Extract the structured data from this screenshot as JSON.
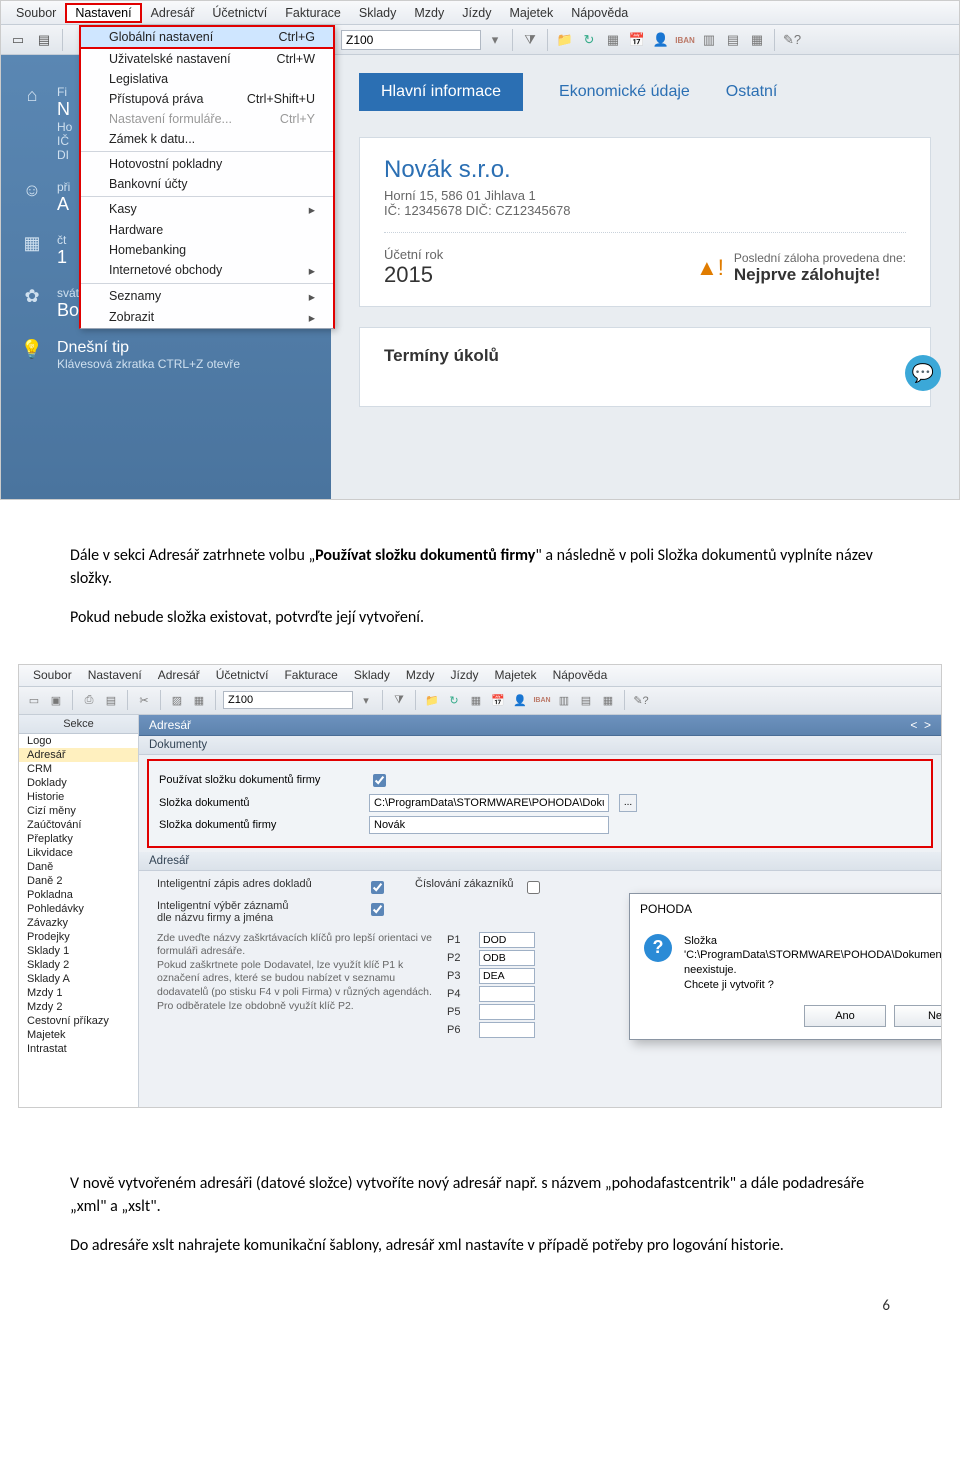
{
  "menubar1": [
    "Soubor",
    "Nastavení",
    "Adresář",
    "Účetnictví",
    "Fakturace",
    "Sklady",
    "Mzdy",
    "Jízdy",
    "Majetek",
    "Nápověda"
  ],
  "menubar1_active_index": 1,
  "dropdown": [
    {
      "label": "Globální nastavení",
      "shortcut": "Ctrl+G",
      "hl": true
    },
    {
      "label": "Uživatelské nastavení",
      "shortcut": "Ctrl+W"
    },
    {
      "label": "Legislativa",
      "shortcut": ""
    },
    {
      "label": "Přístupová práva",
      "shortcut": "Ctrl+Shift+U"
    },
    {
      "label": "Nastavení formuláře...",
      "shortcut": "Ctrl+Y",
      "disabled": true
    },
    {
      "label": "Zámek k datu...",
      "shortcut": ""
    },
    {
      "sep": true
    },
    {
      "label": "Hotovostní pokladny",
      "shortcut": ""
    },
    {
      "label": "Bankovní účty",
      "shortcut": ""
    },
    {
      "sep": true
    },
    {
      "label": "Kasy",
      "arrow": true
    },
    {
      "label": "Hardware",
      "shortcut": ""
    },
    {
      "label": "Homebanking",
      "shortcut": ""
    },
    {
      "label": "Internetové obchody",
      "arrow": true
    },
    {
      "sep": true
    },
    {
      "label": "Seznamy",
      "arrow": true
    },
    {
      "label": "Zobrazit",
      "arrow": true
    }
  ],
  "toolbar_input": "Z100",
  "sidebar1": {
    "firm_label": "Fi",
    "firm_name": "N",
    "firm_addr": "Ho",
    "ic": "IČ",
    "dic": "DI",
    "pri": "při",
    "agenda": "A",
    "ct": "čt",
    "date": "1",
    "svatek_label": "svátek má",
    "svatek_name": "Bonifác",
    "tip_title": "Dnešní tip",
    "tip_text": "Klávesová zkratka CTRL+Z otevře"
  },
  "tabs1": [
    "Hlavní informace",
    "Ekonomické údaje",
    "Ostatní"
  ],
  "card1": {
    "title": "Novák s.r.o.",
    "addr": "Horní 15, 586 01 Jihlava 1",
    "ids": "IČ: 12345678  DIČ: CZ12345678",
    "rok_label": "Účetní rok",
    "rok": "2015",
    "warn1": "Poslední záloha provedena dne:",
    "warn2": "Nejprve zálohujte!"
  },
  "card2_title": "Termíny úkolů",
  "para1": {
    "pre": "Dále v sekci Adresář zatrhnete volbu „",
    "b1": "Používat složku dokumentů firmy",
    "mid": "\" a následně v poli Složka dokumentů vyplníte název složky.",
    "p2": "Pokud nebude složka existovat, potvrďte její vytvoření."
  },
  "menubar2": [
    "Soubor",
    "Nastavení",
    "Adresář",
    "Účetnictví",
    "Fakturace",
    "Sklady",
    "Mzdy",
    "Jízdy",
    "Majetek",
    "Nápověda"
  ],
  "toolbar2_input": "Z100",
  "sekce_header": "Sekce",
  "sekce_items": [
    "Logo",
    "Adresář",
    "CRM",
    "Doklady",
    "Historie",
    "Cizí měny",
    "Zaúčtování",
    "Přeplatky",
    "Likvidace",
    "Daně",
    "Daně 2",
    "Pokladna",
    "Pohledávky",
    "Závazky",
    "Prodejky",
    "Sklady 1",
    "Sklady 2",
    "Sklady A",
    "Mzdy 1",
    "Mzdy 2",
    "Cestovní příkazy",
    "Majetek",
    "Intrastat"
  ],
  "sekce_selected": 1,
  "pathbar_title": "Adresář",
  "section_doc": "Dokumenty",
  "redbox": {
    "r1_label": "Používat složku dokumentů firmy",
    "r2_label": "Složka dokumentů",
    "r2_value": "C:\\ProgramData\\STORMWARE\\POHODA\\Doku...\\",
    "r3_label": "Složka dokumentů firmy",
    "r3_value": "Novák"
  },
  "section_adr": "Adresář",
  "below": {
    "r1": "Inteligentní zápis adres dokladů",
    "r2a": "Inteligentní výběr záznamů",
    "r2b": "dle názvu firmy a jména",
    "cislovani": "Číslování zákazníků",
    "desc": "Zde uveďte názvy zaškrtávacích klíčů pro lepší orientaci ve formuláři adresáře.\nPokud zaškrtnete pole Dodavatel, lze využít klíč P1 k označení adres, které se budou nabízet v seznamu dodavatelů (po stisku F4 v poli Firma) v různých agendách. Pro odběratele lze obdobně využít klíč P2.",
    "p_labels": [
      "P1",
      "P2",
      "P3",
      "P4",
      "P5",
      "P6"
    ],
    "p_vals": [
      "DOD",
      "ODB",
      "DEA",
      "",
      "",
      ""
    ]
  },
  "dialog": {
    "title": "POHODA",
    "msg1": "Složka 'C:\\ProgramData\\STORMWARE\\POHODA\\Dokumenty\\Novák' neexistuje.",
    "msg2": "Chcete ji vytvořit ?",
    "btn_yes": "Ano",
    "btn_no": "Ne"
  },
  "para2": {
    "p1": "V nově vytvořeném adresáři (datové složce) vytvoříte nový adresář např. s názvem „pohodafastcentrik\" a dále podadresáře „xml\" a „xslt\".",
    "p2": "Do adresáře xslt nahrajete komunikační šablony, adresář xml nastavíte v případě potřeby pro logování historie."
  },
  "page_num": "6"
}
